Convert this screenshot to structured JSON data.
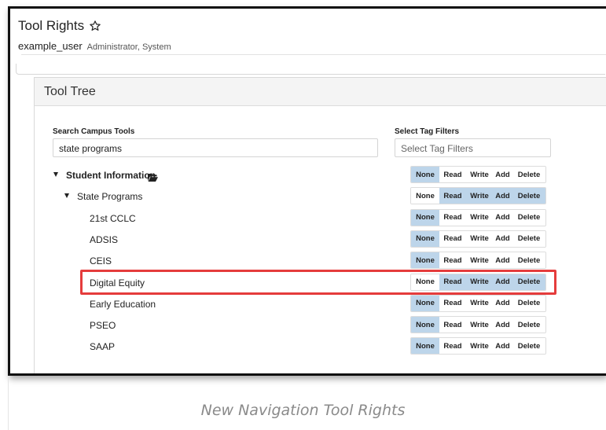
{
  "header": {
    "title": "Tool Rights",
    "star_icon": "star-outline-icon",
    "username": "example_user",
    "roles": "Administrator, System"
  },
  "panel": {
    "title": "Tool Tree",
    "search": {
      "label": "Search Campus Tools",
      "value": "state programs"
    },
    "tags": {
      "label": "Select Tag Filters",
      "placeholder": "Select Tag Filters"
    }
  },
  "rights_labels": [
    "None",
    "Read",
    "Write",
    "Add",
    "Delete"
  ],
  "tree": [
    {
      "label": "Student Information",
      "level": 0,
      "expanded": true,
      "folder": true,
      "rights": {
        "none": true,
        "read": false,
        "write": false,
        "add": false,
        "delete": false
      }
    },
    {
      "label": "State Programs",
      "level": 1,
      "expanded": true,
      "folder": false,
      "rights": {
        "none": false,
        "read": true,
        "write": true,
        "add": true,
        "delete": true
      }
    },
    {
      "label": "21st CCLC",
      "level": 2,
      "rights": {
        "none": true,
        "read": false,
        "write": false,
        "add": false,
        "delete": false
      }
    },
    {
      "label": "ADSIS",
      "level": 2,
      "rights": {
        "none": true,
        "read": false,
        "write": false,
        "add": false,
        "delete": false
      }
    },
    {
      "label": "CEIS",
      "level": 2,
      "rights": {
        "none": true,
        "read": false,
        "write": false,
        "add": false,
        "delete": false
      }
    },
    {
      "label": "Digital Equity",
      "level": 2,
      "highlighted": true,
      "rights": {
        "none": false,
        "read": true,
        "write": true,
        "add": true,
        "delete": true
      }
    },
    {
      "label": "Early Education",
      "level": 2,
      "rights": {
        "none": true,
        "read": false,
        "write": false,
        "add": false,
        "delete": false
      }
    },
    {
      "label": "PSEO",
      "level": 2,
      "rights": {
        "none": true,
        "read": false,
        "write": false,
        "add": false,
        "delete": false
      }
    },
    {
      "label": "SAAP",
      "level": 2,
      "rights": {
        "none": true,
        "read": false,
        "write": false,
        "add": false,
        "delete": false
      }
    }
  ],
  "colors": {
    "selected": "#bdd5ea",
    "highlight": "#e53c3c"
  },
  "caption": "New Navigation Tool Rights"
}
